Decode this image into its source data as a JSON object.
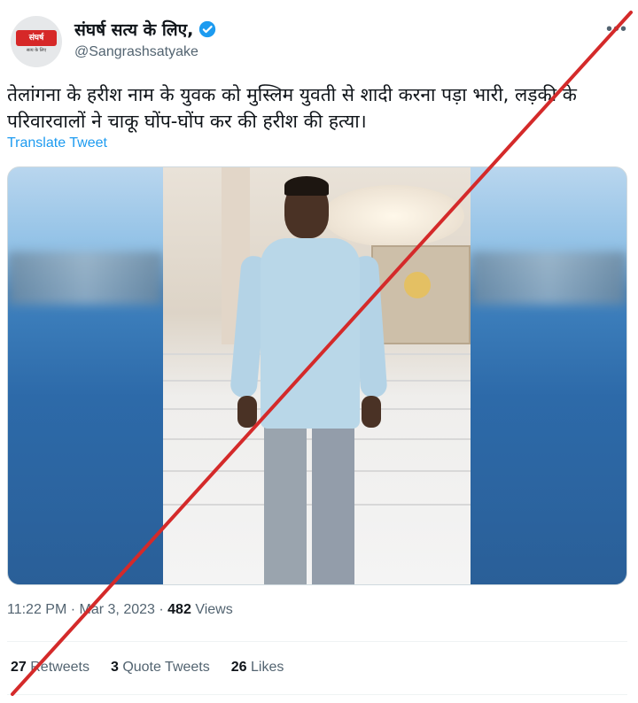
{
  "account": {
    "display_name": "संघर्ष सत्य के लिए,",
    "handle": "@Sangrashsatyake",
    "avatar_logo_text": "संघर्ष",
    "avatar_logo_subtext": "सत्य के लिए",
    "verified": true
  },
  "tweet": {
    "text_line1": "तेलांगना के हरीश नाम के युवक को मुस्लिम युवती से शादी करना पड़ा भारी, लड़की के",
    "text_line2": "परिवारवालों ने चाकू घोंप-घोंप कर की हरीश की हत्या।",
    "translate_label": "Translate Tweet",
    "time": "11:22 PM",
    "separator": "·",
    "date": "Mar 3, 2023",
    "views_count": "482",
    "views_label": "Views"
  },
  "stats": {
    "retweets_count": "27",
    "retweets_label": "Retweets",
    "quote_count": "3",
    "quote_label": "Quote Tweets",
    "likes_count": "26",
    "likes_label": "Likes"
  },
  "icons": {
    "more": "more-icon",
    "verified": "verified-badge-icon"
  },
  "colors": {
    "accent": "#1d9bf0",
    "cross_out": "#d42a2a"
  }
}
